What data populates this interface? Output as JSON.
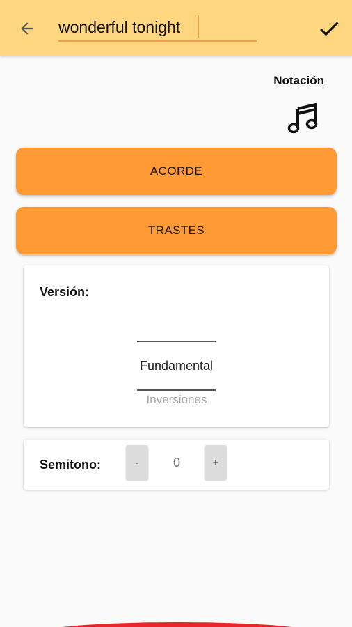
{
  "toolbar": {
    "search_value": "wonderful tonight",
    "back_icon": "arrow-left-icon",
    "confirm_icon": "check-icon",
    "accent_color": "#ffd680"
  },
  "notation": {
    "label": "Notación",
    "icon": "music-notes-icon"
  },
  "buttons": {
    "chord_label": "ACORDE",
    "frets_label": "TRASTES",
    "color": "#ff9a35"
  },
  "version_card": {
    "label": "Versión:",
    "selected_value": "Fundamental",
    "next_option": "Inversiones"
  },
  "semitone_card": {
    "label": "Semitono:",
    "minus_label": "-",
    "value": "0",
    "plus_label": "+"
  }
}
